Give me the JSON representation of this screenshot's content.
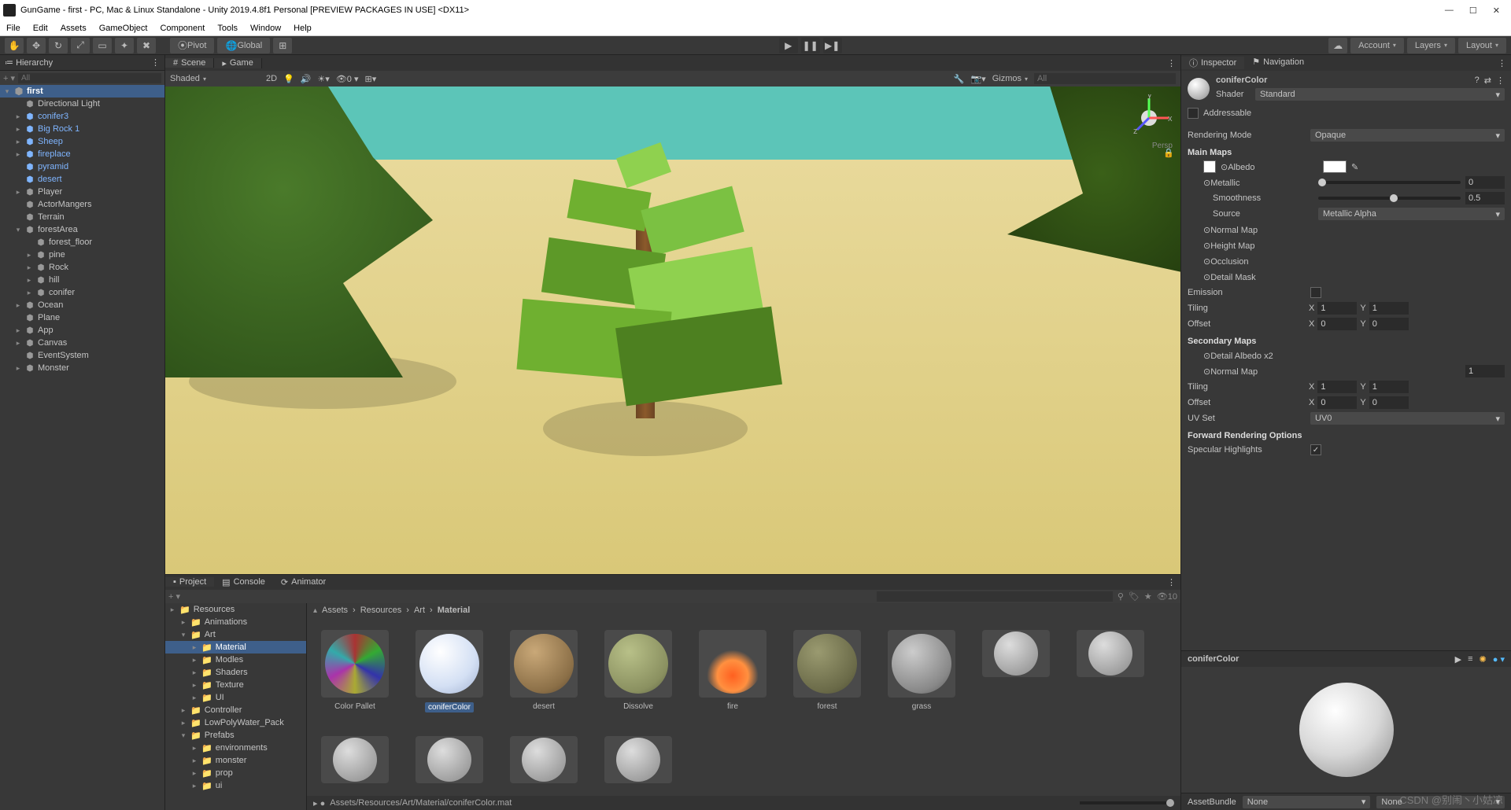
{
  "window": {
    "title": "GunGame - first - PC, Mac & Linux Standalone - Unity 2019.4.8f1 Personal [PREVIEW PACKAGES IN USE] <DX11>"
  },
  "menu": [
    "File",
    "Edit",
    "Assets",
    "GameObject",
    "Component",
    "Tools",
    "Window",
    "Help"
  ],
  "toolbar": {
    "pivot": "Pivot",
    "global": "Global",
    "account": "Account",
    "layers": "Layers",
    "layout": "Layout"
  },
  "hierarchy": {
    "title": "Hierarchy",
    "search_placeholder": "All",
    "scene": "first",
    "items": [
      {
        "name": "Directional Light",
        "depth": 1
      },
      {
        "name": "conifer3",
        "depth": 1,
        "blue": true,
        "exp": true
      },
      {
        "name": "Big Rock 1",
        "depth": 1,
        "blue": true,
        "exp": true
      },
      {
        "name": "Sheep",
        "depth": 1,
        "blue": true,
        "exp": true
      },
      {
        "name": "fireplace",
        "depth": 1,
        "blue": true,
        "exp": true
      },
      {
        "name": "pyramid",
        "depth": 1,
        "blue": true
      },
      {
        "name": "desert",
        "depth": 1,
        "blue": true
      },
      {
        "name": "Player",
        "depth": 1,
        "exp": true
      },
      {
        "name": "ActorMangers",
        "depth": 1
      },
      {
        "name": "Terrain",
        "depth": 1
      },
      {
        "name": "forestArea",
        "depth": 1,
        "open": true
      },
      {
        "name": "forest_floor",
        "depth": 2
      },
      {
        "name": "pine",
        "depth": 2,
        "exp": true
      },
      {
        "name": "Rock",
        "depth": 2,
        "exp": true
      },
      {
        "name": "hill",
        "depth": 2,
        "exp": true
      },
      {
        "name": "conifer",
        "depth": 2,
        "exp": true
      },
      {
        "name": "Ocean",
        "depth": 1,
        "exp": true
      },
      {
        "name": "Plane",
        "depth": 1
      },
      {
        "name": "App",
        "depth": 1,
        "exp": true
      },
      {
        "name": "Canvas",
        "depth": 1,
        "exp": true
      },
      {
        "name": "EventSystem",
        "depth": 1
      },
      {
        "name": "Monster",
        "depth": 1,
        "exp": true
      }
    ]
  },
  "scene": {
    "tab_scene": "Scene",
    "tab_game": "Game",
    "shading": "Shaded",
    "mode2d": "2D",
    "gizmos": "Gizmos",
    "search_placeholder": "All",
    "persp": "Persp"
  },
  "project": {
    "tab_project": "Project",
    "tab_console": "Console",
    "tab_animator": "Animator",
    "folders": [
      {
        "name": "Resources",
        "depth": 0
      },
      {
        "name": "Animations",
        "depth": 1
      },
      {
        "name": "Art",
        "depth": 1,
        "open": true,
        "sel": false
      },
      {
        "name": "Material",
        "depth": 2,
        "sel": true
      },
      {
        "name": "Modles",
        "depth": 2
      },
      {
        "name": "Shaders",
        "depth": 2
      },
      {
        "name": "Texture",
        "depth": 2
      },
      {
        "name": "UI",
        "depth": 2
      },
      {
        "name": "Controller",
        "depth": 1
      },
      {
        "name": "LowPolyWater_Pack",
        "depth": 1
      },
      {
        "name": "Prefabs",
        "depth": 1,
        "open": true
      },
      {
        "name": "environments",
        "depth": 2
      },
      {
        "name": "monster",
        "depth": 2
      },
      {
        "name": "prop",
        "depth": 2
      },
      {
        "name": "ui",
        "depth": 2
      }
    ],
    "breadcrumb": [
      "Assets",
      "Resources",
      "Art",
      "Material"
    ],
    "hidden_count": "10",
    "assets": [
      {
        "name": "Color Pallet",
        "style": "pallet"
      },
      {
        "name": "coniferColor",
        "style": "white",
        "sel": true
      },
      {
        "name": "desert",
        "style": "tan"
      },
      {
        "name": "Dissolve",
        "style": "olive"
      },
      {
        "name": "fire",
        "style": "fire"
      },
      {
        "name": "forest",
        "style": "darkolive"
      },
      {
        "name": "grass",
        "style": "grey"
      }
    ],
    "asset_path": "Assets/Resources/Art/Material/coniferColor.mat"
  },
  "inspector": {
    "tab_inspector": "Inspector",
    "tab_navigation": "Navigation",
    "material_name": "coniferColor",
    "shader_label": "Shader",
    "shader_value": "Standard",
    "addressable": "Addressable",
    "rendering_mode_label": "Rendering Mode",
    "rendering_mode": "Opaque",
    "main_maps": "Main Maps",
    "albedo": "Albedo",
    "metallic": "Metallic",
    "metallic_val": "0",
    "smoothness": "Smoothness",
    "smoothness_val": "0.5",
    "source": "Source",
    "source_val": "Metallic Alpha",
    "normal_map": "Normal Map",
    "height_map": "Height Map",
    "occlusion": "Occlusion",
    "detail_mask": "Detail Mask",
    "emission": "Emission",
    "tiling": "Tiling",
    "offset": "Offset",
    "tiling_x": "1",
    "tiling_y": "1",
    "offset_x": "0",
    "offset_y": "0",
    "secondary_maps": "Secondary Maps",
    "detail_albedo": "Detail Albedo x2",
    "normal_map2": "Normal Map",
    "normal_map2_val": "1",
    "tiling2_x": "1",
    "tiling2_y": "1",
    "offset2_x": "0",
    "offset2_y": "0",
    "uv_set": "UV Set",
    "uv_set_val": "UV0",
    "fwd_opts": "Forward Rendering Options",
    "spec_hl": "Specular Highlights",
    "preview_name": "coniferColor",
    "assetbundle_label": "AssetBundle",
    "assetbundle_none": "None"
  },
  "watermark": "CSDN @别闹丶小姑凉"
}
